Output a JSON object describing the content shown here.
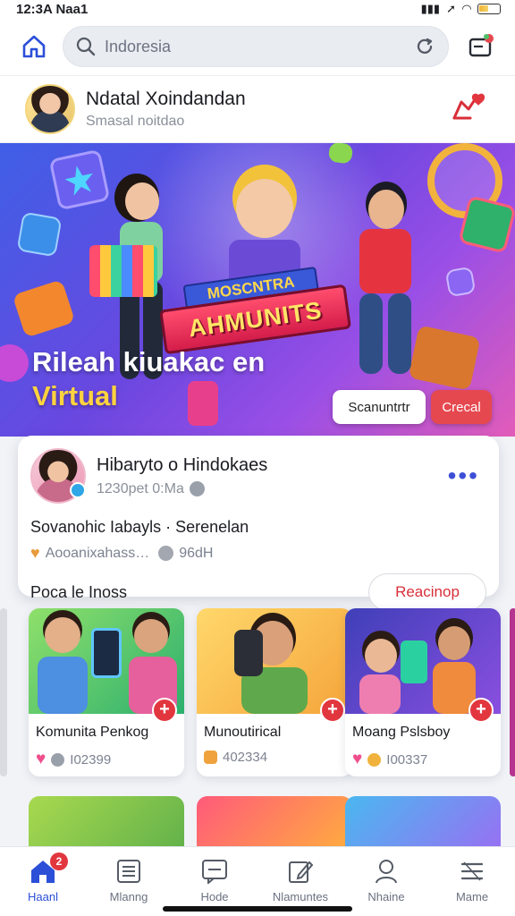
{
  "status_bar": {
    "time": "12:3A Naa1"
  },
  "search": {
    "placeholder": "Indoresia"
  },
  "profile": {
    "name": "Ndatal Xoindandan",
    "subtitle": "Smasal noitdao"
  },
  "banner": {
    "ribbon_top": "MOSCNTRA",
    "ribbon_main": "AHMUNITS",
    "title_line1": "Rileah kiuakac en",
    "title_line2": "Virtual",
    "secondary_button": "Scanuntrtr",
    "primary_button": "Crecal"
  },
  "post": {
    "author": "Hibaryto o Hindokaes",
    "time": "1230pet 0:Ma",
    "text": "Sovanohic Iabayls · Serenelan",
    "reactions": "Aooanixahass…",
    "reaction_count": "96dH",
    "action_label": "Poca le Inoss",
    "action_button": "Reacinop",
    "more": "•••"
  },
  "communities": [
    {
      "title": "Komunita Penkog",
      "count": "I02399"
    },
    {
      "title": "Munoutirical",
      "count": "402334"
    },
    {
      "title": "Moang Pslsboy",
      "count": "I00337"
    }
  ],
  "nav": {
    "items": [
      {
        "label": "Haanl",
        "icon": "home-icon"
      },
      {
        "label": "Mlanng",
        "icon": "list-icon"
      },
      {
        "label": "Hode",
        "icon": "chat-icon"
      },
      {
        "label": "Nlamuntes",
        "icon": "edit-icon"
      },
      {
        "label": "Nhaine",
        "icon": "profile-icon"
      },
      {
        "label": "Mame",
        "icon": "menu-icon"
      }
    ],
    "badge_count": "2"
  },
  "colors": {
    "accent": "#2c4fd8",
    "danger": "#e2363f",
    "banner_start": "#3f5fe6",
    "banner_end": "#e25cb9"
  }
}
